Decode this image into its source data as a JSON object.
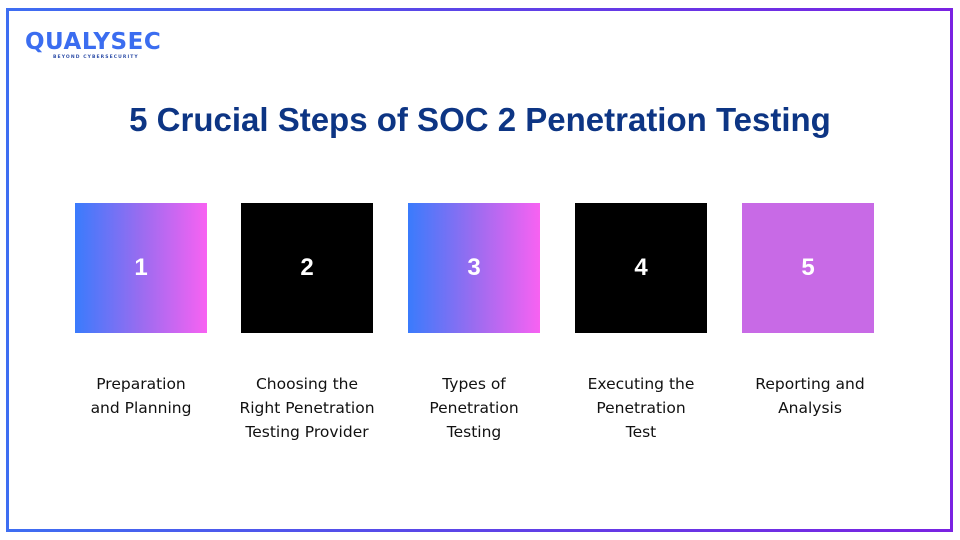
{
  "brand": {
    "name": "QUALYSEC",
    "tagline": "BEYOND CYBERSECURITY",
    "logo_icon": "shield-q-logo-icon",
    "colors": {
      "logo": "#3b6df0",
      "border_start": "#3e6ef2",
      "border_end": "#7a22e2"
    }
  },
  "title": "5 Crucial Steps of SOC 2 Penetration Testing",
  "title_color": "#0d3584",
  "steps": [
    {
      "number": "1",
      "style": "gradient",
      "label_lines": [
        "Preparation",
        "and Planning"
      ]
    },
    {
      "number": "2",
      "style": "black",
      "label_lines": [
        "Choosing the",
        "Right Penetration",
        "Testing Provider"
      ]
    },
    {
      "number": "3",
      "style": "gradient",
      "label_lines": [
        "Types of",
        "Penetration",
        "Testing"
      ]
    },
    {
      "number": "4",
      "style": "black",
      "label_lines": [
        "Executing the",
        "Penetration",
        "Test"
      ]
    },
    {
      "number": "5",
      "style": "violet",
      "label_lines": [
        "Reporting and",
        "Analysis"
      ]
    }
  ],
  "colors": {
    "gradient_start": "#3a7bfc",
    "gradient_end": "#f862f2",
    "black": "#000000",
    "violet": "#c86ae6"
  }
}
